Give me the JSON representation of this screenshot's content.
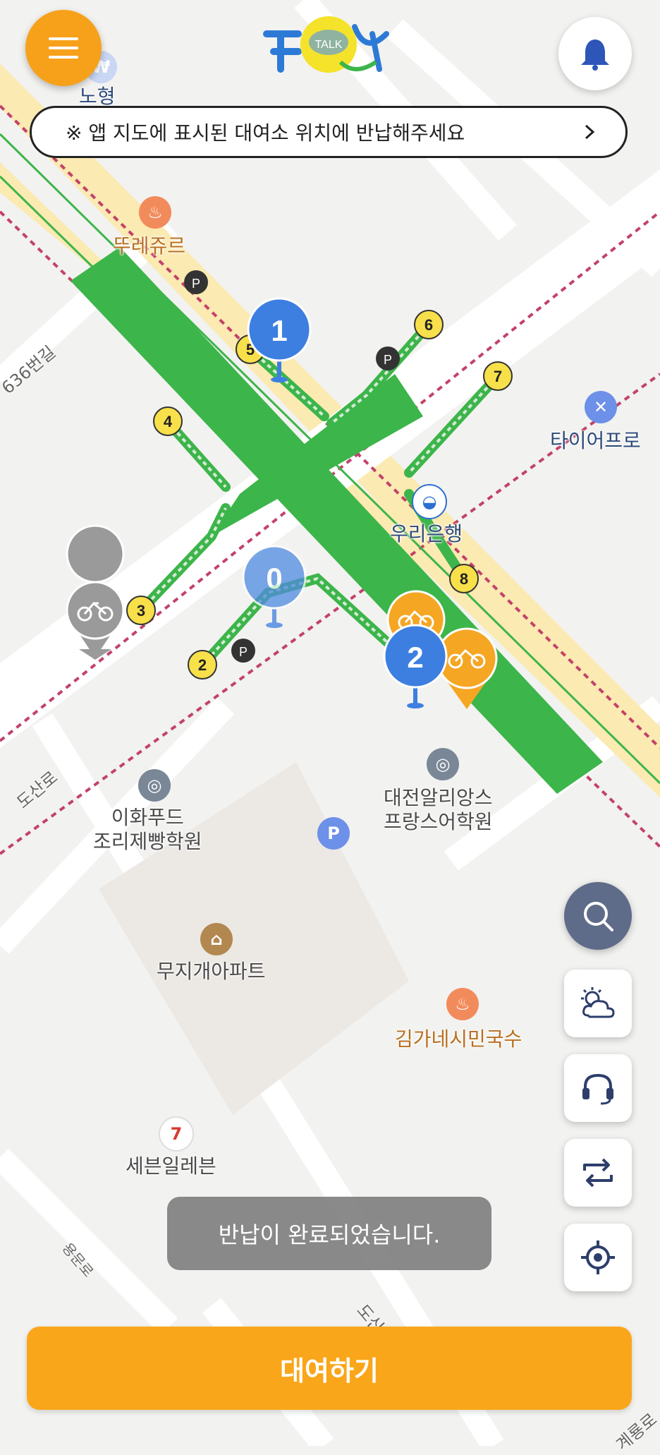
{
  "notice": {
    "text": "※ 앱 지도에 표시된 대여소 위치에 반납해주세요"
  },
  "logo": {
    "talk_label": "TALK"
  },
  "toast": {
    "text": "반납이 완료되었습니다."
  },
  "rent_button": {
    "label": "대여하기"
  },
  "map": {
    "pois": [
      {
        "id": "ttreju",
        "label": "뚜레쥬르",
        "type": "food"
      },
      {
        "id": "tirepro",
        "label": "타이어프로",
        "type": "service"
      },
      {
        "id": "woori",
        "label": "우리은행",
        "type": "bank"
      },
      {
        "id": "ihwa",
        "label": "이화푸드\n조리제빵학원",
        "type": "school"
      },
      {
        "id": "alliance",
        "label": "대전알리앙스\n프랑스어학원",
        "type": "school"
      },
      {
        "id": "muji",
        "label": "무지개아파트",
        "type": "apartment"
      },
      {
        "id": "kimga",
        "label": "김가네시민국수",
        "type": "food"
      },
      {
        "id": "seven",
        "label": "세븐일레븐",
        "type": "convenience"
      }
    ],
    "roads": {
      "dosan": "도산로",
      "r636": "636번길",
      "dosan2": "도산",
      "gyeryong": "계룡로",
      "yongmun": "용문로"
    },
    "top_partial_label": "노형",
    "station_markers": [
      "1",
      "0",
      "2"
    ],
    "exits": [
      "2",
      "3",
      "4",
      "5",
      "6",
      "7",
      "8"
    ],
    "colors": {
      "accent": "#f7a11a",
      "crosswalk_green": "#3cb54a",
      "marker_blue": "#3d7fe0",
      "bike_orange": "#f5a623"
    }
  },
  "icons": [
    "menu-icon",
    "bell-icon",
    "search-icon",
    "weather-icon",
    "headset-icon",
    "swap-icon",
    "locate-icon",
    "bike-icon",
    "parking-icon"
  ]
}
